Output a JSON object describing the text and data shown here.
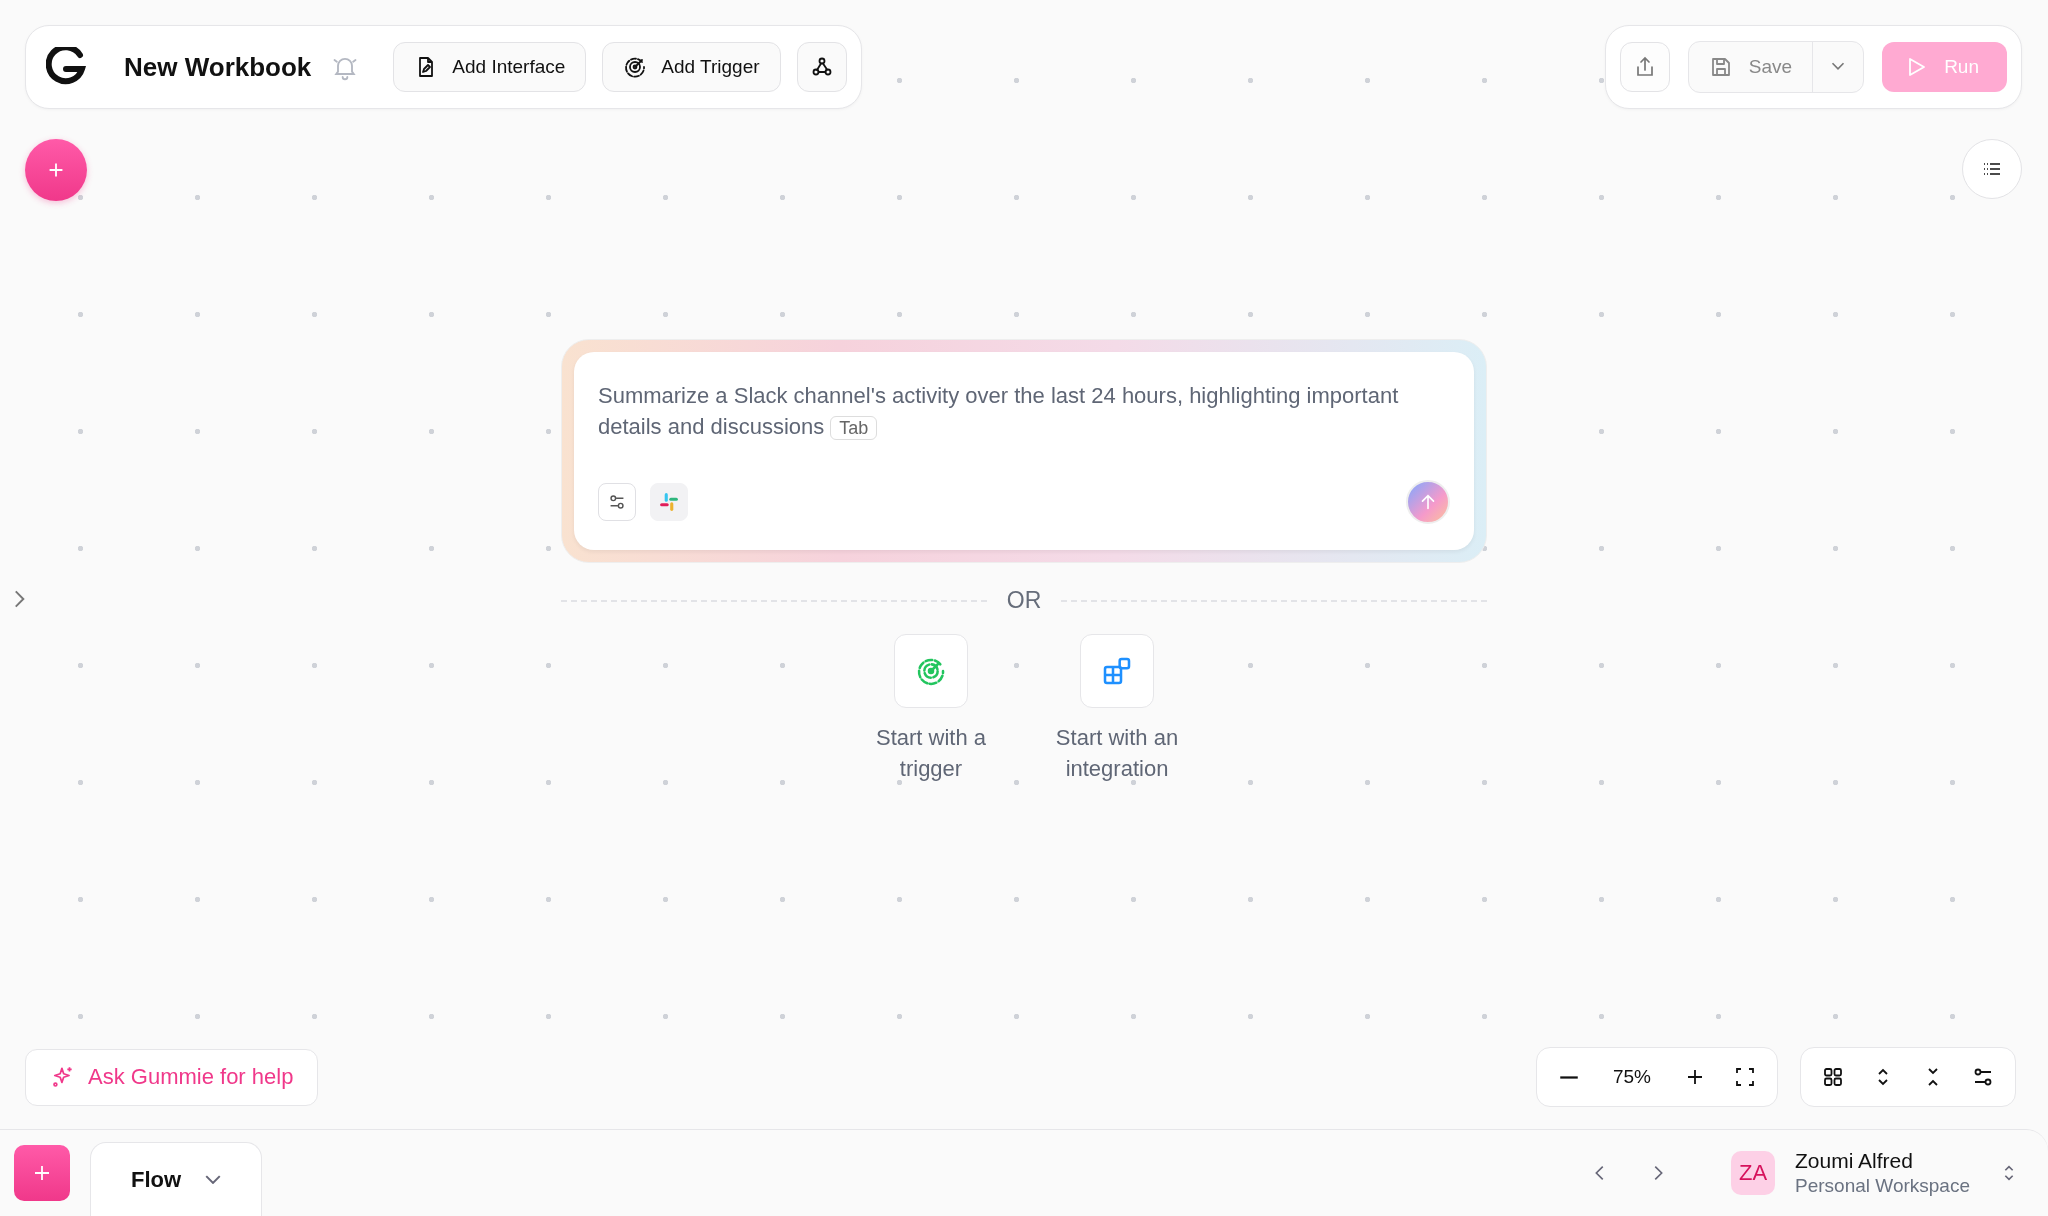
{
  "header": {
    "title": "New Workbook",
    "buttons": [
      {
        "label": "Add Interface",
        "kind": "interface"
      },
      {
        "label": "Add Trigger",
        "kind": "trigger"
      }
    ]
  },
  "actions": {
    "save": "Save",
    "run": {
      "label": "Run",
      "disabled": true
    }
  },
  "prompt": {
    "text": "Summarize a Slack channel's activity over the last 24 hours, highlighting important details and discussions",
    "key_hint": "Tab"
  },
  "divider": "OR",
  "options": [
    {
      "label": "Start with a trigger",
      "kind": "trigger"
    },
    {
      "label": "Start with an integration",
      "kind": "integration"
    }
  ],
  "help_button": "Ask Gummie for help",
  "zoom": "75%",
  "bottom_bar": {
    "tabs": [
      {
        "label": "Flow",
        "selected": true
      }
    ],
    "user": {
      "initials": "ZA",
      "name": "Zoumi Alfred",
      "workspace": "Personal Workspace"
    }
  }
}
